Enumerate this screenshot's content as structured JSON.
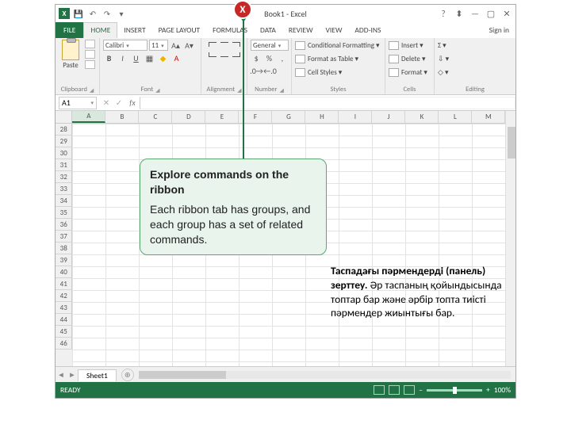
{
  "marker_letter": "X",
  "titlebar": {
    "app_title": "Book1 - Excel",
    "qat": {
      "save": "💾",
      "undo": "↶",
      "redo": "↷",
      "more": "▾"
    }
  },
  "window_controls": {
    "help": "?",
    "ribbon_opts": "⬍",
    "min": "—",
    "max": "▢",
    "close": "✕"
  },
  "tabs": {
    "file": "FILE",
    "list": [
      "HOME",
      "INSERT",
      "PAGE LAYOUT",
      "FORMULAS",
      "DATA",
      "REVIEW",
      "VIEW",
      "ADD-INS"
    ],
    "active_index": 0,
    "signin": "Sign in"
  },
  "ribbon": {
    "clipboard": {
      "label": "Clipboard",
      "paste": "Paste"
    },
    "font": {
      "label": "Font",
      "name": "Calibri",
      "size": "11",
      "inc": "A▴",
      "dec": "A▾",
      "bold": "B",
      "italic": "I",
      "underline": "U"
    },
    "alignment": {
      "label": "Alignment"
    },
    "number": {
      "label": "Number",
      "format": "General"
    },
    "styles": {
      "label": "Styles",
      "cond": "Conditional Formatting ▾",
      "table": "Format as Table ▾",
      "cell": "Cell Styles ▾"
    },
    "cells": {
      "label": "Cells",
      "insert": "Insert ▾",
      "delete": "Delete ▾",
      "format": "Format ▾"
    },
    "editing": {
      "label": "Editing",
      "sum": "Σ ▾",
      "fill": "⇩ ▾",
      "clear": "◇ ▾"
    }
  },
  "formula_bar": {
    "name_box": "A1",
    "cancel": "✕",
    "enter": "✓",
    "fx": "fx"
  },
  "grid": {
    "columns": [
      "A",
      "B",
      "C",
      "D",
      "E",
      "F",
      "G",
      "H",
      "I",
      "J",
      "K",
      "L",
      "M"
    ],
    "row_start": 28,
    "row_end": 46
  },
  "sheet_tabs": {
    "nav_prev": "◄",
    "nav_next": "►",
    "sheet": "Sheet1",
    "add": "⊕"
  },
  "statusbar": {
    "ready": "READY",
    "zoom_minus": "–",
    "zoom_plus": "+",
    "zoom": "100%"
  },
  "callout": {
    "title": "Explore commands on the ribbon",
    "body": "Each ribbon tab has groups, and each group has a set of related commands."
  },
  "kazakh": {
    "title": "Таспадағы пәрмендерді (панель) зерттеу.",
    "body": "Әр таспаның қойындысында топтар бар және әрбір топта тиісті пәрмендер жиынтығы бар."
  }
}
